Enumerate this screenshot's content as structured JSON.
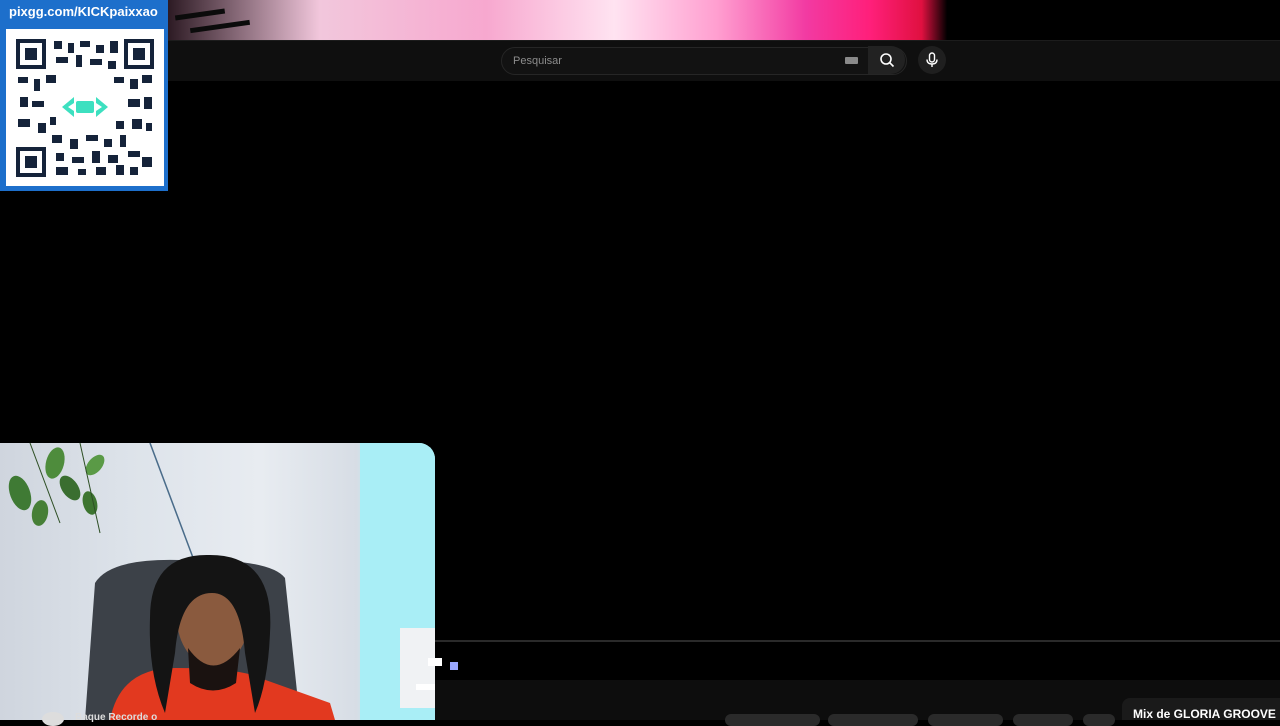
{
  "overlay": {
    "donation_url": "pixgg.com/KICKpaixxao"
  },
  "search": {
    "placeholder": "Pesquisar"
  },
  "icons": {
    "keyboard": "keyboard-icon",
    "search": "search-icon",
    "mic": "mic-icon",
    "qr": "qr-code-icon"
  },
  "bottom": {
    "mix_title": "Mix de GLORIA GROOVE",
    "channel_label": "Baque Recorde o"
  },
  "colors": {
    "qr_panel": "#1d6fcb",
    "background": "#000000",
    "search_bg": "#121212"
  }
}
